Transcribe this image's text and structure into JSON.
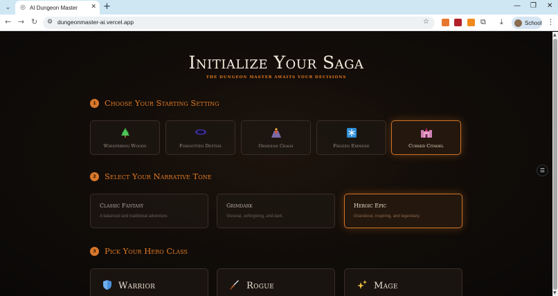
{
  "browser": {
    "tab_title": "AI Dungeon Master",
    "tab_favicon": "globe-icon",
    "url": "dungeonmaster-ai.vercel.app",
    "profile_label": "School"
  },
  "hero": {
    "title": "Initialize Your Saga",
    "subtitle": "The Dungeon Master awaits your decisions"
  },
  "steps": [
    {
      "number": "1",
      "label": "Choose Your Starting Setting"
    },
    {
      "number": "2",
      "label": "Select Your Narrative Tone"
    },
    {
      "number": "3",
      "label": "Pick Your Hero Class"
    }
  ],
  "settings": [
    {
      "label": "Whispering Woods",
      "icon": "tree-icon",
      "selected": false
    },
    {
      "label": "Forgotten Depths",
      "icon": "portal-icon",
      "selected": false
    },
    {
      "label": "Obsidian Crags",
      "icon": "volcano-icon",
      "selected": false
    },
    {
      "label": "Frozen Expanse",
      "icon": "snowflake-icon",
      "selected": false
    },
    {
      "label": "Cursed Citadel",
      "icon": "castle-icon",
      "selected": true
    }
  ],
  "tones": [
    {
      "title": "Classic Fantasy",
      "description": "A balanced and traditional adventure.",
      "selected": false
    },
    {
      "title": "Grimdark",
      "description": "Visceral, unforgiving, and dark.",
      "selected": false
    },
    {
      "title": "Heroic Epic",
      "description": "Grandiose, inspiring, and legendary.",
      "selected": true
    }
  ],
  "classes": [
    {
      "label": "Warrior",
      "icon": "shield-icon"
    },
    {
      "label": "Rogue",
      "icon": "dagger-icon"
    },
    {
      "label": "Mage",
      "icon": "sparkles-icon"
    }
  ],
  "colors": {
    "accent": "#e07a24",
    "background": "#0d0a08",
    "selected_border": "#d07428"
  }
}
